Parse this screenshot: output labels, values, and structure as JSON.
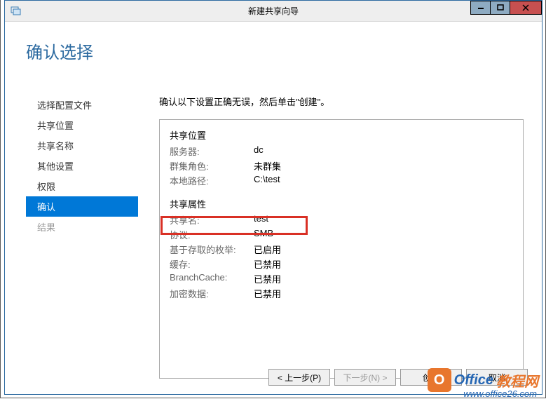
{
  "titlebar": {
    "title": "新建共享向导"
  },
  "page": {
    "heading": "确认选择",
    "instruction": "确认以下设置正确无误，然后单击\"创建\"。"
  },
  "nav": {
    "items": [
      {
        "label": "选择配置文件"
      },
      {
        "label": "共享位置"
      },
      {
        "label": "共享名称"
      },
      {
        "label": "其他设置"
      },
      {
        "label": "权限"
      },
      {
        "label": "确认"
      },
      {
        "label": "结果"
      }
    ]
  },
  "details": {
    "location": {
      "title": "共享位置",
      "server_label": "服务器:",
      "server_value": "dc",
      "cluster_label": "群集角色:",
      "cluster_value": "未群集",
      "path_label": "本地路径:",
      "path_value": "C:\\test"
    },
    "properties": {
      "title": "共享属性",
      "name_label": "共享名:",
      "name_value": "test",
      "protocol_label": "协议:",
      "protocol_value": "SMB",
      "enum_label": "基于存取的枚举:",
      "enum_value": "已启用",
      "cache_label": "缓存:",
      "cache_value": "已禁用",
      "branch_label": "BranchCache:",
      "branch_value": "已禁用",
      "encrypt_label": "加密数据:",
      "encrypt_value": "已禁用"
    }
  },
  "footer": {
    "prev": "< 上一步(P)",
    "next": "下一步(N) >",
    "create": "创建",
    "cancel": "取消"
  },
  "watermark": {
    "badge": "O",
    "text1": "Office",
    "text2": "教程网",
    "url": "www.office26.com"
  }
}
